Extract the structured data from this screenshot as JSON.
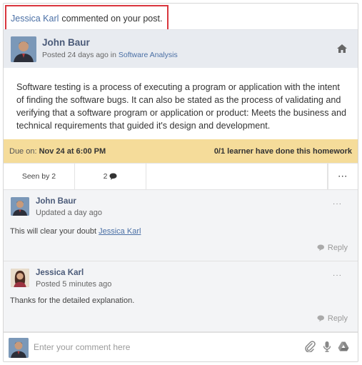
{
  "notification": {
    "actor": "Jessica Karl",
    "message": "commented on your post."
  },
  "post": {
    "author": "John Baur",
    "posted": "Posted 24 days ago",
    "in_word": "in",
    "category": "Software Analysis",
    "body": "Software testing is a process of executing a program or application with the intent of finding the software bugs. It can also be stated as the process of validating and verifying that a software program or application or product: Meets the business and technical requirements that guided it's design and development."
  },
  "due": {
    "label": "Due on:",
    "date": "Nov 24 at 6:00 PM",
    "progress": "0/1 learner have done this homework"
  },
  "actions": {
    "seen": "Seen by 2",
    "comment_count": "2",
    "more": "···"
  },
  "comments": [
    {
      "author": "John Baur",
      "time": "Updated a day ago",
      "text": "This will clear your doubt",
      "mention": "Jessica Karl",
      "reply": "Reply",
      "more": "···"
    },
    {
      "author": "Jessica Karl",
      "time": "Posted 5 minutes ago",
      "text": "Thanks for the detailed explanation.",
      "reply": "Reply",
      "more": "···"
    }
  ],
  "composer": {
    "placeholder": "Enter your comment here"
  },
  "colors": {
    "accent": "#4a6fa5",
    "due_bar": "#f5dc9a",
    "highlight_border": "#d9363e"
  },
  "icons": [
    "home-icon",
    "comment-icon",
    "more-icon",
    "reply-icon",
    "paperclip-icon",
    "microphone-icon",
    "drive-icon"
  ]
}
